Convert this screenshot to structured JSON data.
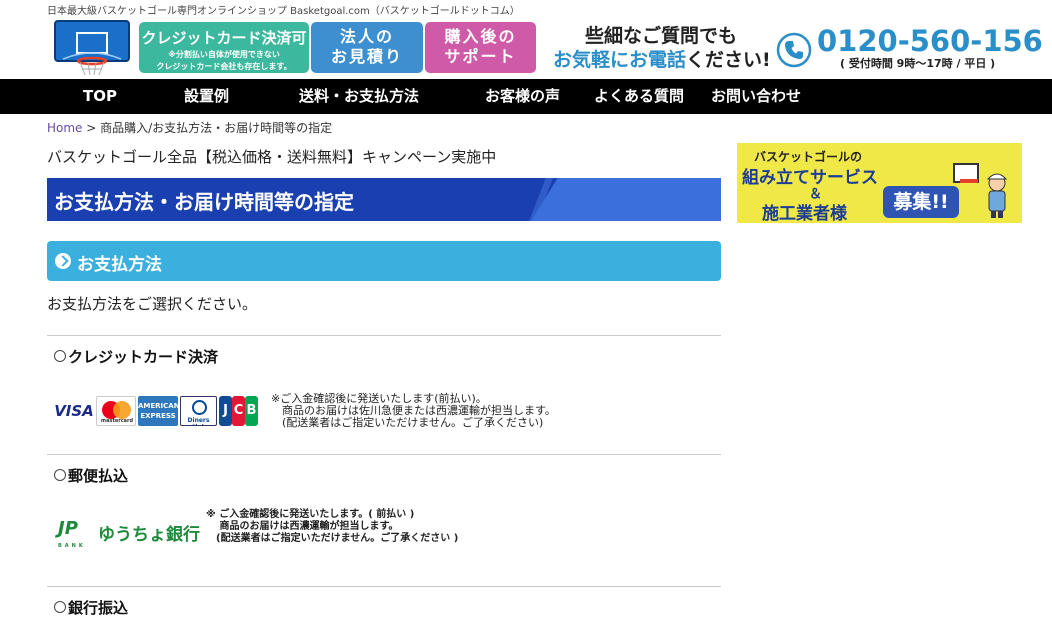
{
  "header": {
    "tagline": "日本最大級バスケットゴール専門オンラインショップ Basketgoal.com（バスケットゴールドットコム）",
    "credit_main": "クレジットカード決済可",
    "credit_sub1": "※分割払い自体が使用できない",
    "credit_sub2": "クレジットカード会社も存在します。",
    "estimate_l1": "法人の",
    "estimate_l2": "お見積り",
    "support_l1": "購入後の",
    "support_l2": "サポート",
    "phone_msg_l1": "些細なご質問でも",
    "phone_msg_l2_blue": "お気軽にお電話",
    "phone_msg_l2_black": "ください!",
    "phone_number": "0120-560-156",
    "phone_hours": "( 受付時間  9時～17時 / 平日 )"
  },
  "nav": {
    "items": [
      {
        "label": "TOP"
      },
      {
        "label": "設置例"
      },
      {
        "label": "送料・お支払方法"
      },
      {
        "label": "お客様の声"
      },
      {
        "label": "よくある質問"
      },
      {
        "label": "お問い合わせ"
      }
    ]
  },
  "breadcrumb": {
    "home": "Home",
    "separator": " > ",
    "current": "商品購入/お支払方法・お届け時間等の指定"
  },
  "main": {
    "campaign": "バスケットゴール全品【税込価格・送料無料】キャンペーン実施中",
    "page_title": "お支払方法・お届け時間等の指定",
    "section_title": "お支払方法",
    "instruction": "お支払方法をご選択ください。",
    "methods": [
      {
        "label": "クレジットカード決済",
        "note_lines": [
          "※ご入金確認後に発送いたします(前払い)。",
          "　商品のお届けは佐川急便または西濃運輸が担当します。",
          "　(配送業者はご指定いただけません。ご了承ください)"
        ]
      },
      {
        "label": "郵便払込",
        "note_lines": [
          "※ ご入金確認後に発送いたします。( 前払い )",
          "　 商品のお届けは西濃運輸が担当します。",
          "　(配送業者はご指定いただけません。ご了承ください )"
        ]
      },
      {
        "label": "銀行振込"
      }
    ],
    "card_logos": {
      "visa": "VISA",
      "mastercard": "mastercard",
      "amex_l1": "AMERICAN",
      "amex_l2": "EXPRESS",
      "diners": "Diners Club",
      "jcb_j": "J",
      "jcb_c": "C",
      "jcb_b": "B"
    },
    "yucho": {
      "mark": "JP",
      "bank": "BANK",
      "name": "ゆうちょ銀行"
    }
  },
  "side_banner": {
    "line1": "バスケットゴールの",
    "line2": "組み立てサービス",
    "amp": "＆",
    "line3": "施工業者様",
    "badge": "募集!!"
  },
  "colors": {
    "nav_bg": "#000000",
    "title_bg": "#1a3fb0",
    "section_bg": "#3bb0df",
    "link": "#6a4ba0",
    "accent_blue": "#2a8ec8"
  }
}
